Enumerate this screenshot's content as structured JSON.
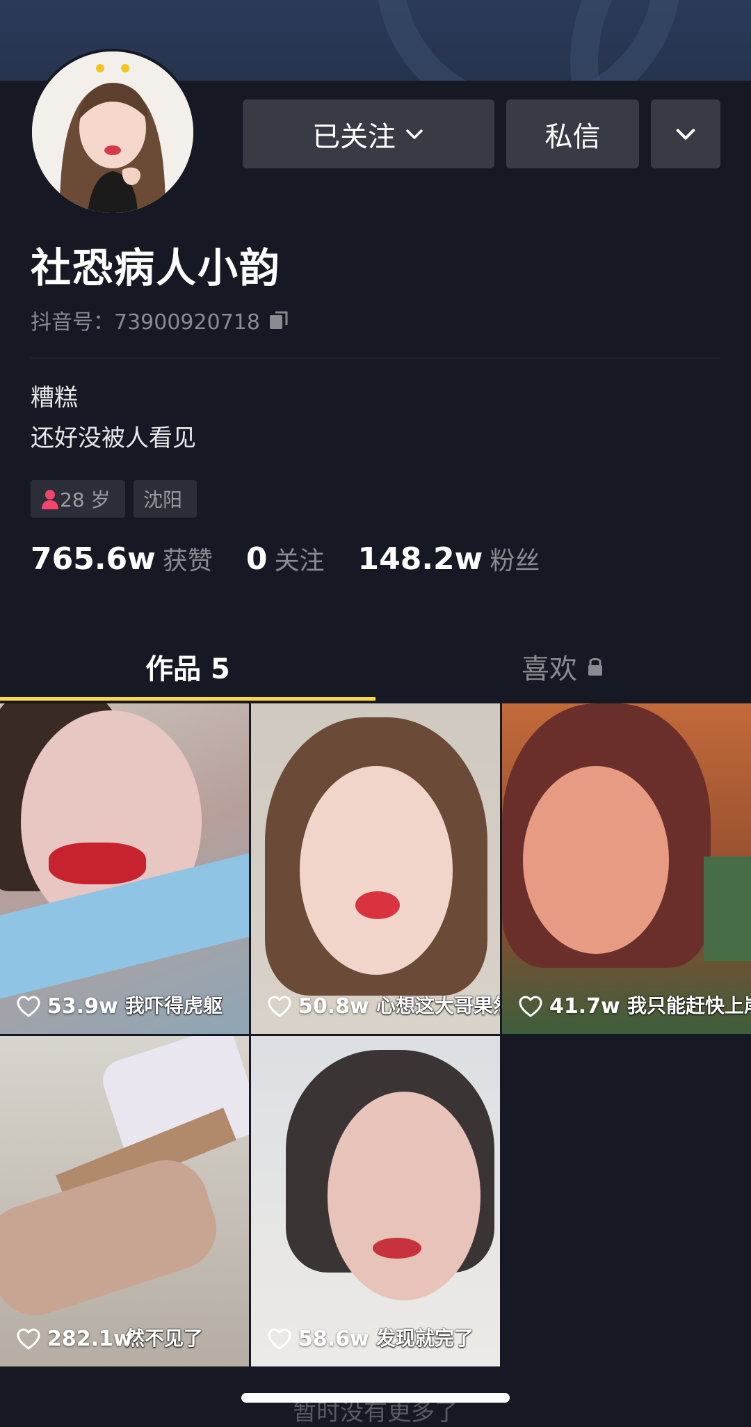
{
  "header": {
    "follow_button_label": "已关注",
    "message_button_label": "私信"
  },
  "profile": {
    "nickname": "社恐病人小韵",
    "douyin_id_label": "抖音号：",
    "douyin_id": "73900920718",
    "bio_line1": "糟糕",
    "bio_line2": "还好没被人看见",
    "tags": {
      "age": "28 岁",
      "city": "沈阳"
    }
  },
  "stats": [
    {
      "value": "765.6w",
      "label": "获赞"
    },
    {
      "value": "0",
      "label": "关注"
    },
    {
      "value": "148.2w",
      "label": "粉丝"
    }
  ],
  "tabs": {
    "works": "作品 5",
    "likes": "喜欢"
  },
  "videos": [
    {
      "likes": "53.9w",
      "caption": "我吓得虎躯"
    },
    {
      "likes": "50.8w",
      "caption": "心想这大哥果然会没"
    },
    {
      "likes": "41.7w",
      "caption": "我只能赶快上岸找"
    },
    {
      "likes": "282.1w",
      "caption": "然不见了"
    },
    {
      "likes": "58.6w",
      "caption": "发现就完了"
    }
  ],
  "footer": {
    "no_more": "暂时没有更多了"
  },
  "colors": {
    "background": "#161823",
    "button": "#393b44",
    "tab_indicator": "#f8d94a",
    "female_icon": "#f5456d"
  }
}
